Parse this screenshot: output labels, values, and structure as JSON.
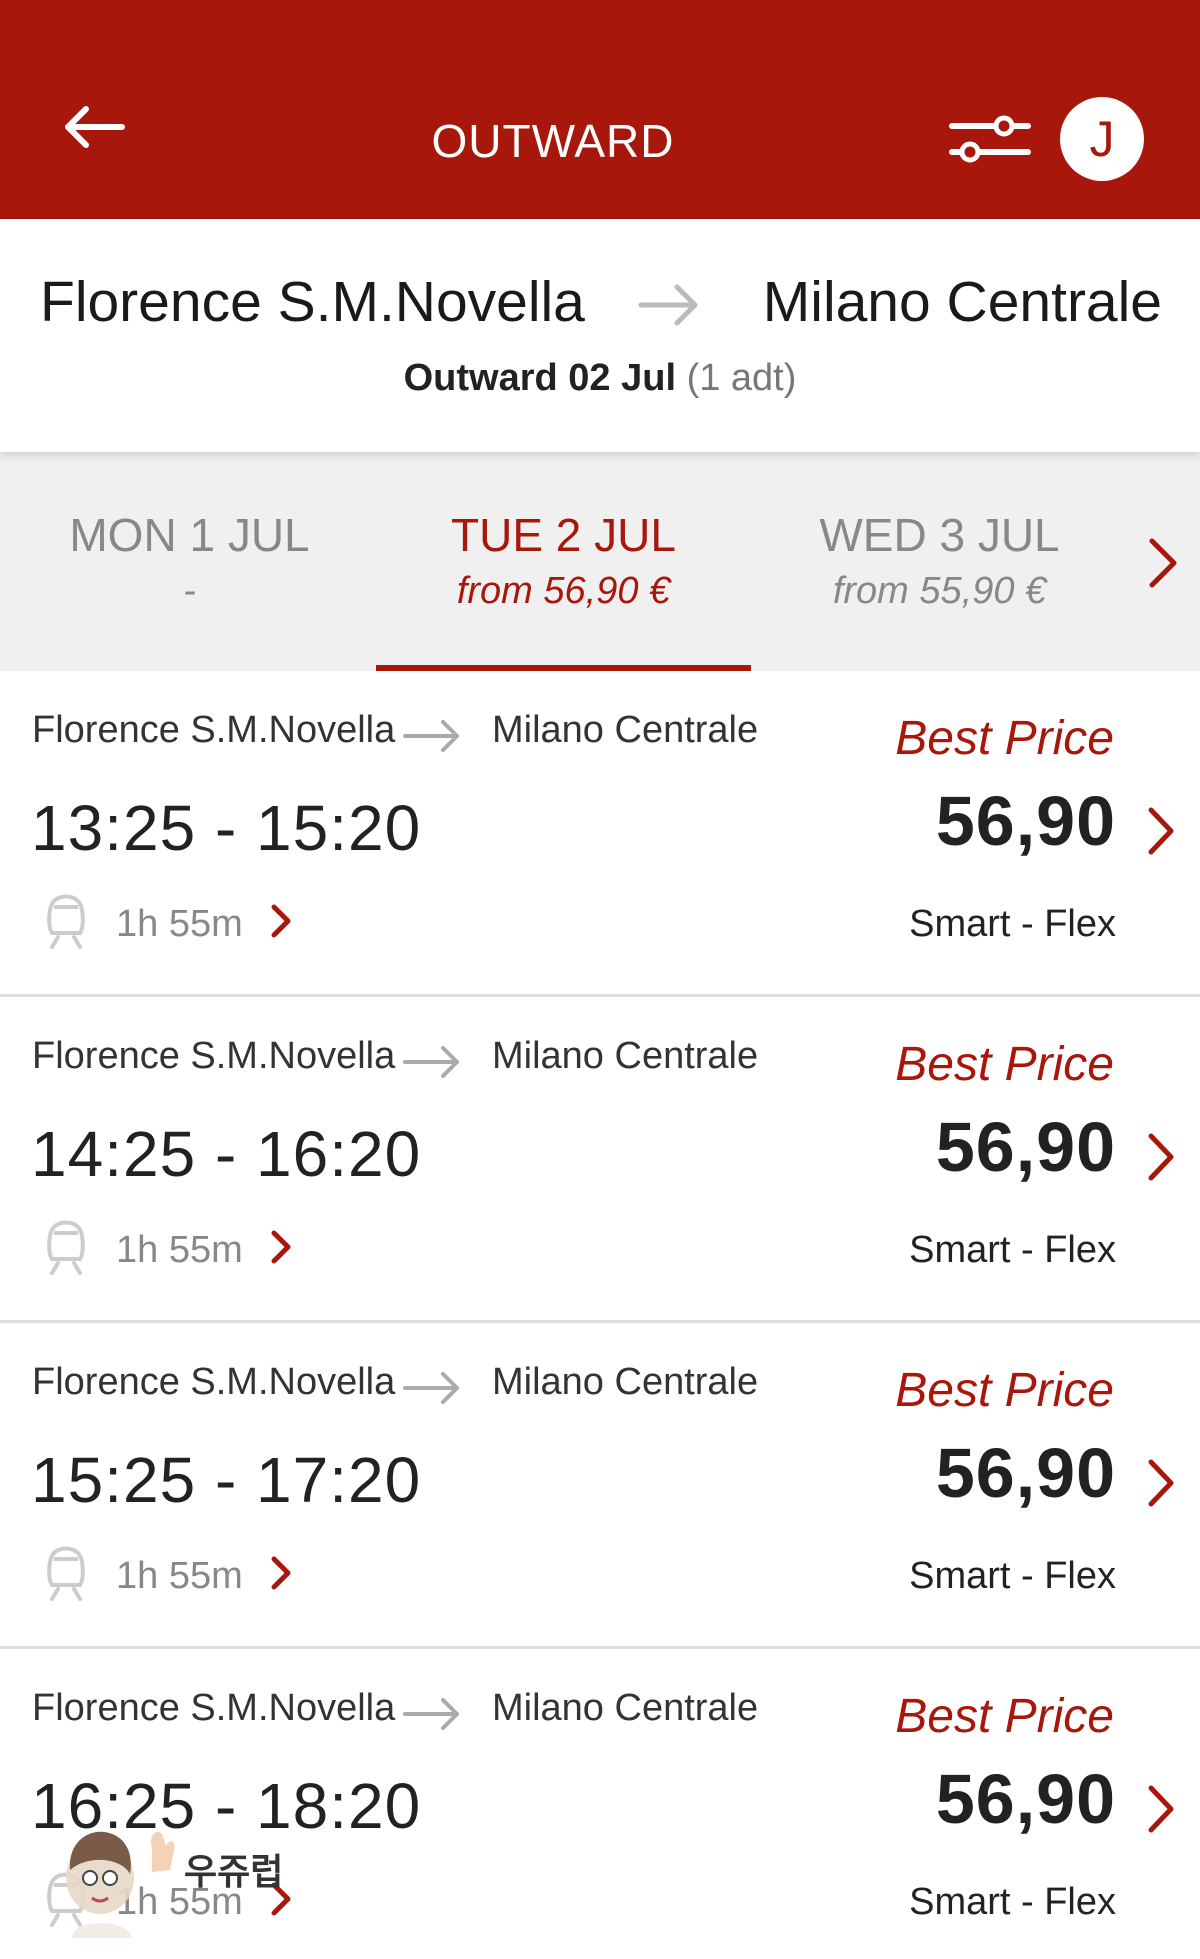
{
  "header": {
    "title": "OUTWARD",
    "avatar_initial": "J",
    "colors": {
      "brand": "#a8170c",
      "text_on_brand": "#ffffff"
    },
    "icons": {
      "back": "arrow-left-icon",
      "filter": "sliders-icon"
    }
  },
  "route": {
    "from": "Florence S.M.Novella",
    "to": "Milano Centrale",
    "subtitle_bold": "Outward 02 Jul",
    "subtitle_passengers": "(1 adt)"
  },
  "date_tabs": [
    {
      "day": "MON 1 JUL",
      "price": "-",
      "active": false
    },
    {
      "day": "TUE 2 JUL",
      "price": "from 56,90 €",
      "active": true
    },
    {
      "day": "WED 3 JUL",
      "price": "from 55,90 €",
      "active": false
    }
  ],
  "journeys": [
    {
      "from": "Florence S.M.Novella",
      "to": "Milano Centrale",
      "times": "13:25 - 15:20",
      "duration": "1h 55m",
      "fare_label": "Best Price",
      "price": "56,90",
      "fare_class": "Smart - Flex"
    },
    {
      "from": "Florence S.M.Novella",
      "to": "Milano Centrale",
      "times": "14:25 - 16:20",
      "duration": "1h 55m",
      "fare_label": "Best Price",
      "price": "56,90",
      "fare_class": "Smart - Flex"
    },
    {
      "from": "Florence S.M.Novella",
      "to": "Milano Centrale",
      "times": "15:25 - 17:20",
      "duration": "1h 55m",
      "fare_label": "Best Price",
      "price": "56,90",
      "fare_class": "Smart - Flex"
    },
    {
      "from": "Florence S.M.Novella",
      "to": "Milano Centrale",
      "times": "16:25 - 18:20",
      "duration": "1h 55m",
      "fare_label": "Best Price",
      "price": "56,90",
      "fare_class": "Smart - Flex"
    }
  ],
  "watermark": {
    "text": "우쥬럽"
  }
}
